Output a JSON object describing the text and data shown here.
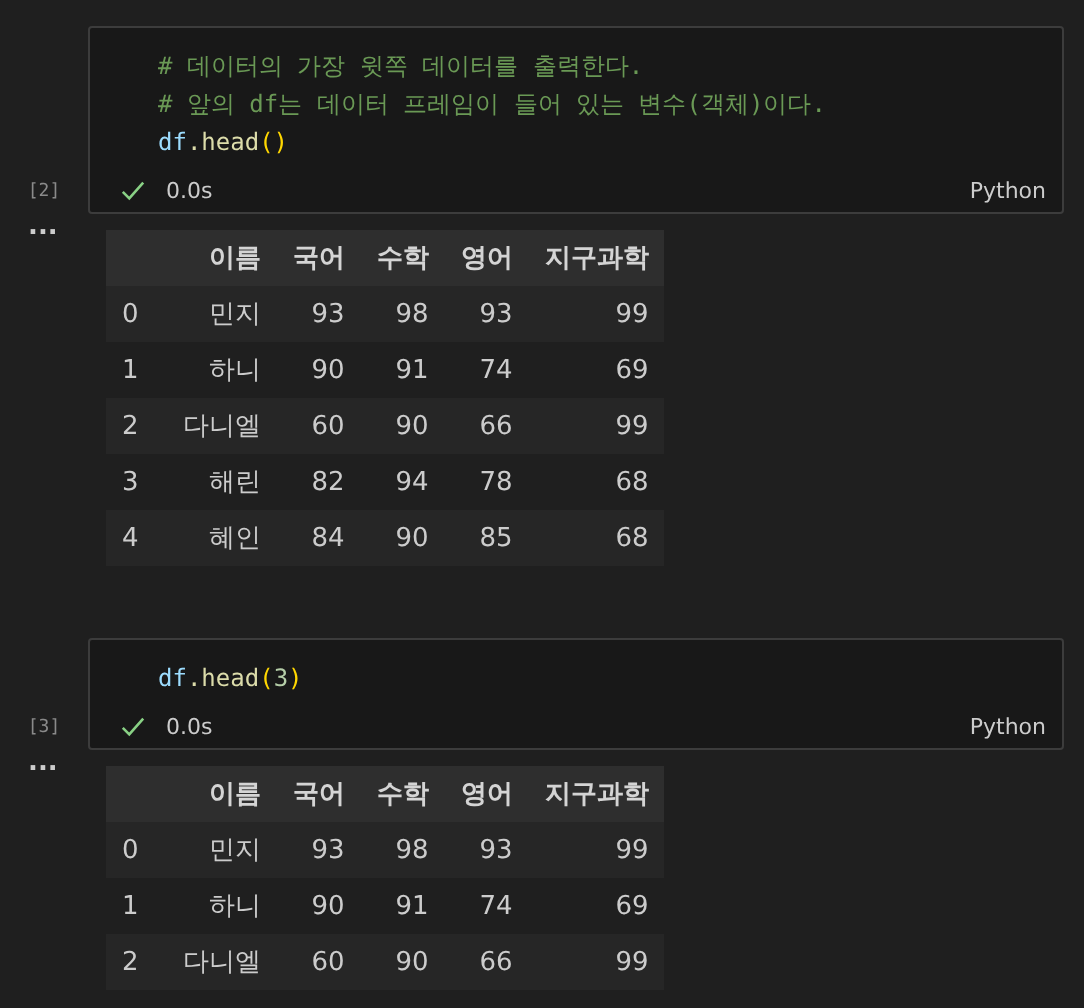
{
  "cells": [
    {
      "execution_count": "[2]",
      "code": [
        [
          {
            "text": "# 데이터의 가장 윗쪽 데이터를 출력한다.",
            "kind": "comment"
          }
        ],
        [
          {
            "text": "# 앞의 df는 데이터 프레임이 들어 있는 변수(객체)이다.",
            "kind": "comment"
          }
        ],
        [
          {
            "text": "df",
            "kind": "variable"
          },
          {
            "text": ".head",
            "kind": "function"
          },
          {
            "text": "()",
            "kind": "bracket"
          }
        ]
      ],
      "status": {
        "succeeded": true,
        "time": "0.0s",
        "language": "Python"
      },
      "output_marker": "...",
      "table": {
        "columns": [
          "",
          "이름",
          "국어",
          "수학",
          "영어",
          "지구과학"
        ],
        "rows": [
          [
            "0",
            "민지",
            "93",
            "98",
            "93",
            "99"
          ],
          [
            "1",
            "하니",
            "90",
            "91",
            "74",
            "69"
          ],
          [
            "2",
            "다니엘",
            "60",
            "90",
            "66",
            "99"
          ],
          [
            "3",
            "해린",
            "82",
            "94",
            "78",
            "68"
          ],
          [
            "4",
            "혜인",
            "84",
            "90",
            "85",
            "68"
          ]
        ]
      }
    },
    {
      "execution_count": "[3]",
      "code": [
        [
          {
            "text": "df",
            "kind": "variable"
          },
          {
            "text": ".head",
            "kind": "function"
          },
          {
            "text": "(",
            "kind": "bracket"
          },
          {
            "text": "3",
            "kind": "number"
          },
          {
            "text": ")",
            "kind": "bracket"
          }
        ]
      ],
      "status": {
        "succeeded": true,
        "time": "0.0s",
        "language": "Python"
      },
      "output_marker": "...",
      "table": {
        "columns": [
          "",
          "이름",
          "국어",
          "수학",
          "영어",
          "지구과학"
        ],
        "rows": [
          [
            "0",
            "민지",
            "93",
            "98",
            "93",
            "99"
          ],
          [
            "1",
            "하니",
            "90",
            "91",
            "74",
            "69"
          ],
          [
            "2",
            "다니엘",
            "60",
            "90",
            "66",
            "99"
          ]
        ]
      }
    }
  ]
}
